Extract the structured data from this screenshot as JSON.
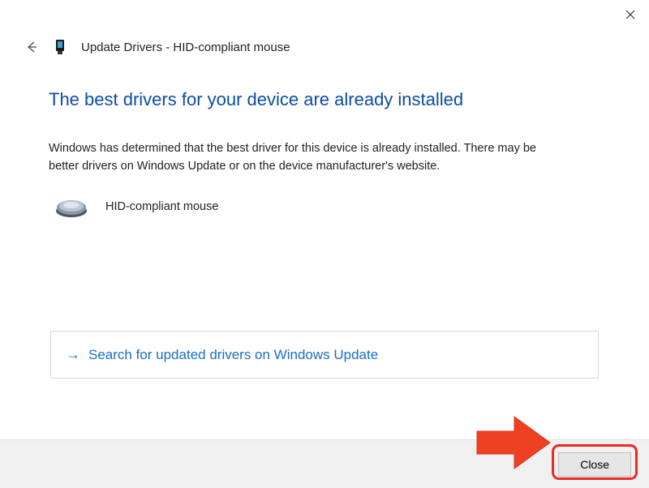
{
  "window": {
    "title": "Update Drivers - HID-compliant mouse"
  },
  "main": {
    "headline": "The best drivers for your device are already installed",
    "description": "Windows has determined that the best driver for this device is already installed. There may be better drivers on Windows Update or on the device manufacturer's website.",
    "device_name": "HID-compliant mouse"
  },
  "action": {
    "label": "Search for updated drivers on Windows Update"
  },
  "buttons": {
    "close": "Close"
  }
}
